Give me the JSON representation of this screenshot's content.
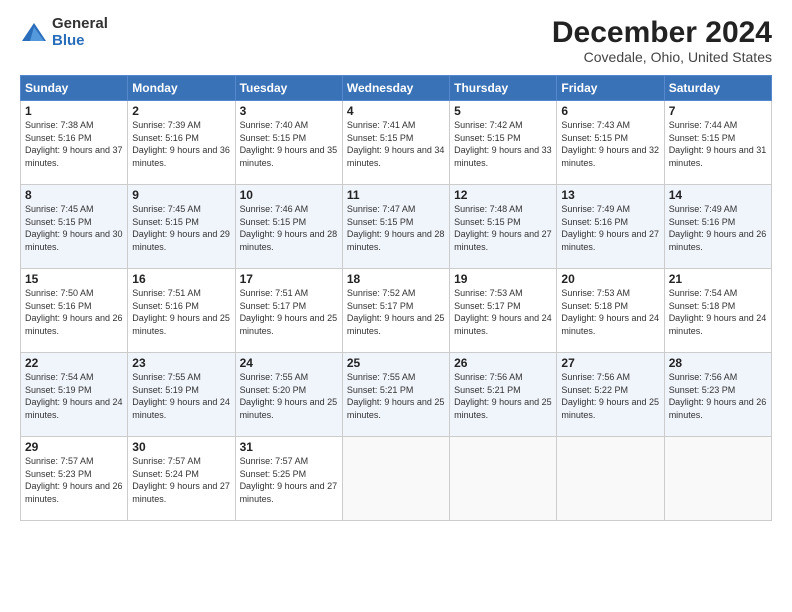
{
  "logo": {
    "general": "General",
    "blue": "Blue"
  },
  "title": "December 2024",
  "location": "Covedale, Ohio, United States",
  "days_of_week": [
    "Sunday",
    "Monday",
    "Tuesday",
    "Wednesday",
    "Thursday",
    "Friday",
    "Saturday"
  ],
  "weeks": [
    [
      {
        "day": "1",
        "sunrise": "7:38 AM",
        "sunset": "5:16 PM",
        "daylight": "9 hours and 37 minutes."
      },
      {
        "day": "2",
        "sunrise": "7:39 AM",
        "sunset": "5:16 PM",
        "daylight": "9 hours and 36 minutes."
      },
      {
        "day": "3",
        "sunrise": "7:40 AM",
        "sunset": "5:15 PM",
        "daylight": "9 hours and 35 minutes."
      },
      {
        "day": "4",
        "sunrise": "7:41 AM",
        "sunset": "5:15 PM",
        "daylight": "9 hours and 34 minutes."
      },
      {
        "day": "5",
        "sunrise": "7:42 AM",
        "sunset": "5:15 PM",
        "daylight": "9 hours and 33 minutes."
      },
      {
        "day": "6",
        "sunrise": "7:43 AM",
        "sunset": "5:15 PM",
        "daylight": "9 hours and 32 minutes."
      },
      {
        "day": "7",
        "sunrise": "7:44 AM",
        "sunset": "5:15 PM",
        "daylight": "9 hours and 31 minutes."
      }
    ],
    [
      {
        "day": "8",
        "sunrise": "7:45 AM",
        "sunset": "5:15 PM",
        "daylight": "9 hours and 30 minutes."
      },
      {
        "day": "9",
        "sunrise": "7:45 AM",
        "sunset": "5:15 PM",
        "daylight": "9 hours and 29 minutes."
      },
      {
        "day": "10",
        "sunrise": "7:46 AM",
        "sunset": "5:15 PM",
        "daylight": "9 hours and 28 minutes."
      },
      {
        "day": "11",
        "sunrise": "7:47 AM",
        "sunset": "5:15 PM",
        "daylight": "9 hours and 28 minutes."
      },
      {
        "day": "12",
        "sunrise": "7:48 AM",
        "sunset": "5:15 PM",
        "daylight": "9 hours and 27 minutes."
      },
      {
        "day": "13",
        "sunrise": "7:49 AM",
        "sunset": "5:16 PM",
        "daylight": "9 hours and 27 minutes."
      },
      {
        "day": "14",
        "sunrise": "7:49 AM",
        "sunset": "5:16 PM",
        "daylight": "9 hours and 26 minutes."
      }
    ],
    [
      {
        "day": "15",
        "sunrise": "7:50 AM",
        "sunset": "5:16 PM",
        "daylight": "9 hours and 26 minutes."
      },
      {
        "day": "16",
        "sunrise": "7:51 AM",
        "sunset": "5:16 PM",
        "daylight": "9 hours and 25 minutes."
      },
      {
        "day": "17",
        "sunrise": "7:51 AM",
        "sunset": "5:17 PM",
        "daylight": "9 hours and 25 minutes."
      },
      {
        "day": "18",
        "sunrise": "7:52 AM",
        "sunset": "5:17 PM",
        "daylight": "9 hours and 25 minutes."
      },
      {
        "day": "19",
        "sunrise": "7:53 AM",
        "sunset": "5:17 PM",
        "daylight": "9 hours and 24 minutes."
      },
      {
        "day": "20",
        "sunrise": "7:53 AM",
        "sunset": "5:18 PM",
        "daylight": "9 hours and 24 minutes."
      },
      {
        "day": "21",
        "sunrise": "7:54 AM",
        "sunset": "5:18 PM",
        "daylight": "9 hours and 24 minutes."
      }
    ],
    [
      {
        "day": "22",
        "sunrise": "7:54 AM",
        "sunset": "5:19 PM",
        "daylight": "9 hours and 24 minutes."
      },
      {
        "day": "23",
        "sunrise": "7:55 AM",
        "sunset": "5:19 PM",
        "daylight": "9 hours and 24 minutes."
      },
      {
        "day": "24",
        "sunrise": "7:55 AM",
        "sunset": "5:20 PM",
        "daylight": "9 hours and 25 minutes."
      },
      {
        "day": "25",
        "sunrise": "7:55 AM",
        "sunset": "5:21 PM",
        "daylight": "9 hours and 25 minutes."
      },
      {
        "day": "26",
        "sunrise": "7:56 AM",
        "sunset": "5:21 PM",
        "daylight": "9 hours and 25 minutes."
      },
      {
        "day": "27",
        "sunrise": "7:56 AM",
        "sunset": "5:22 PM",
        "daylight": "9 hours and 25 minutes."
      },
      {
        "day": "28",
        "sunrise": "7:56 AM",
        "sunset": "5:23 PM",
        "daylight": "9 hours and 26 minutes."
      }
    ],
    [
      {
        "day": "29",
        "sunrise": "7:57 AM",
        "sunset": "5:23 PM",
        "daylight": "9 hours and 26 minutes."
      },
      {
        "day": "30",
        "sunrise": "7:57 AM",
        "sunset": "5:24 PM",
        "daylight": "9 hours and 27 minutes."
      },
      {
        "day": "31",
        "sunrise": "7:57 AM",
        "sunset": "5:25 PM",
        "daylight": "9 hours and 27 minutes."
      },
      null,
      null,
      null,
      null
    ]
  ]
}
